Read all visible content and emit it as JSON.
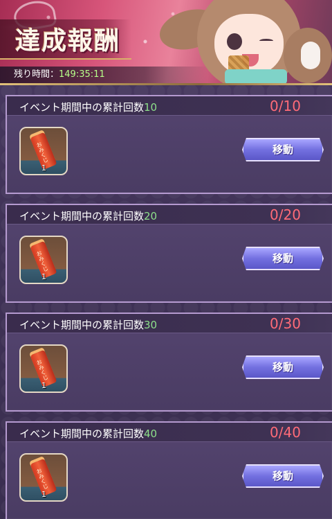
{
  "header": {
    "title": "達成報酬",
    "timer_label": "残り時間：",
    "timer_value": "149:35:11"
  },
  "rewards": [
    {
      "label": "イベント期間中の累計回数",
      "target": "10",
      "progress": "0/10",
      "item_name": "おみくじ",
      "item_count": "1",
      "button": "移動"
    },
    {
      "label": "イベント期間中の累計回数",
      "target": "20",
      "progress": "0/20",
      "item_name": "おみくじ",
      "item_count": "1",
      "button": "移動"
    },
    {
      "label": "イベント期間中の累計回数",
      "target": "30",
      "progress": "0/30",
      "item_name": "おみくじ",
      "item_count": "1",
      "button": "移動"
    },
    {
      "label": "イベント期間中の累計回数",
      "target": "40",
      "progress": "0/40",
      "item_name": "おみくじ",
      "item_count": "1",
      "button": "移動"
    }
  ],
  "colors": {
    "progress": "#ff6b78",
    "target_number": "#8de08a",
    "timer_value": "#b7ff8a",
    "button": "#7370e0"
  }
}
